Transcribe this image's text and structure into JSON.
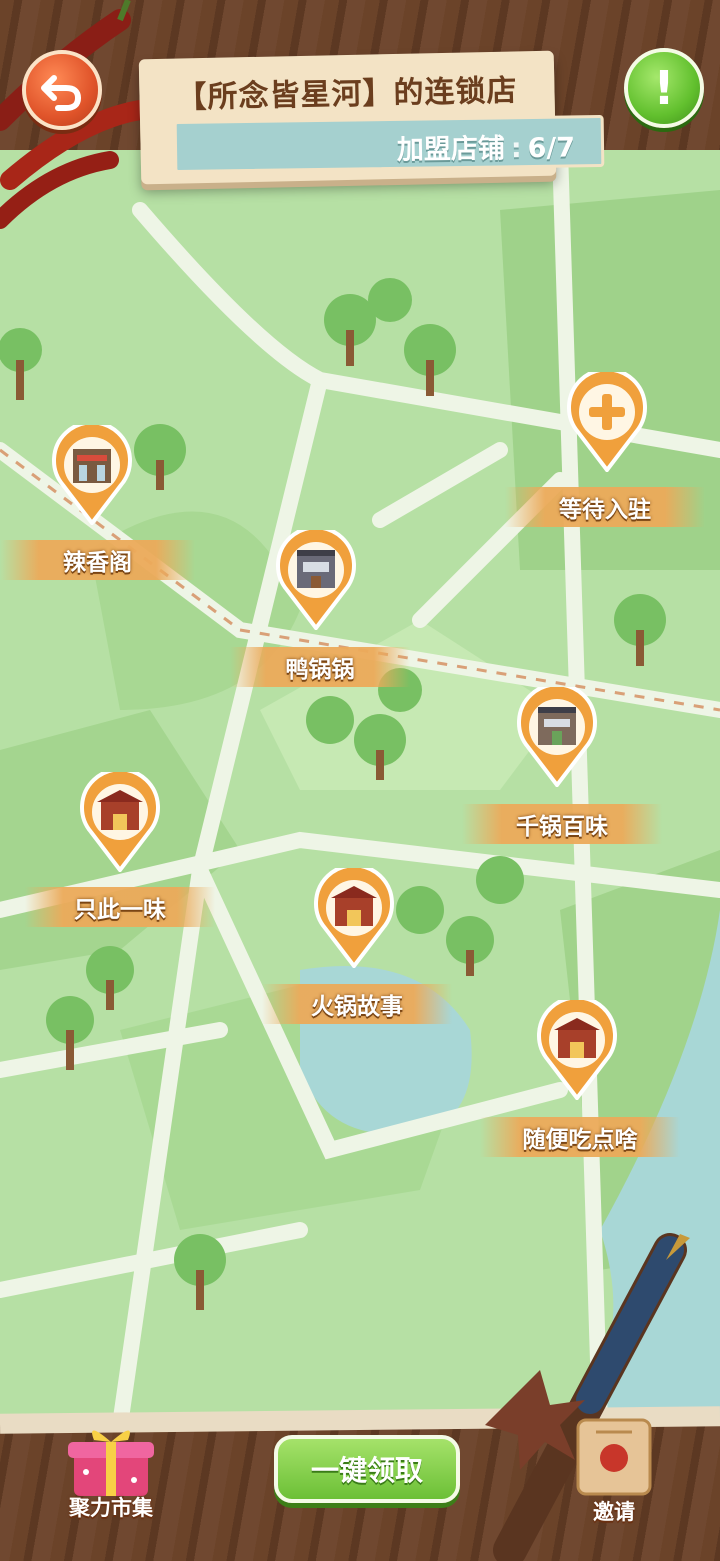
{
  "header": {
    "title": "【所念皆星河】的连锁店",
    "count_label": "加盟店铺",
    "count_sep": ":",
    "count_value": "6/7",
    "back_icon": "back-arrow-icon",
    "info_icon": "exclamation-icon",
    "info_glyph": "!"
  },
  "stores": [
    {
      "name": "辣香阁",
      "icon": "shop-icon"
    },
    {
      "name": "鸭锅锅",
      "icon": "shop-icon"
    },
    {
      "name": "等待入驻",
      "icon": "plus-icon"
    },
    {
      "name": "千锅百味",
      "icon": "shop-icon"
    },
    {
      "name": "只此一味",
      "icon": "restaurant-icon"
    },
    {
      "name": "火锅故事",
      "icon": "restaurant-icon"
    },
    {
      "name": "随便吃点啥",
      "icon": "restaurant-icon"
    }
  ],
  "bottom": {
    "market_label": "聚力市集",
    "claim_label": "一键领取",
    "invite_label": "邀请"
  },
  "colors": {
    "map_green": "#b6e0a4",
    "road": "#eef5e6",
    "pin_orange": "#f0a03c",
    "accent_green": "#6cc036",
    "back_red": "#e0542a"
  }
}
